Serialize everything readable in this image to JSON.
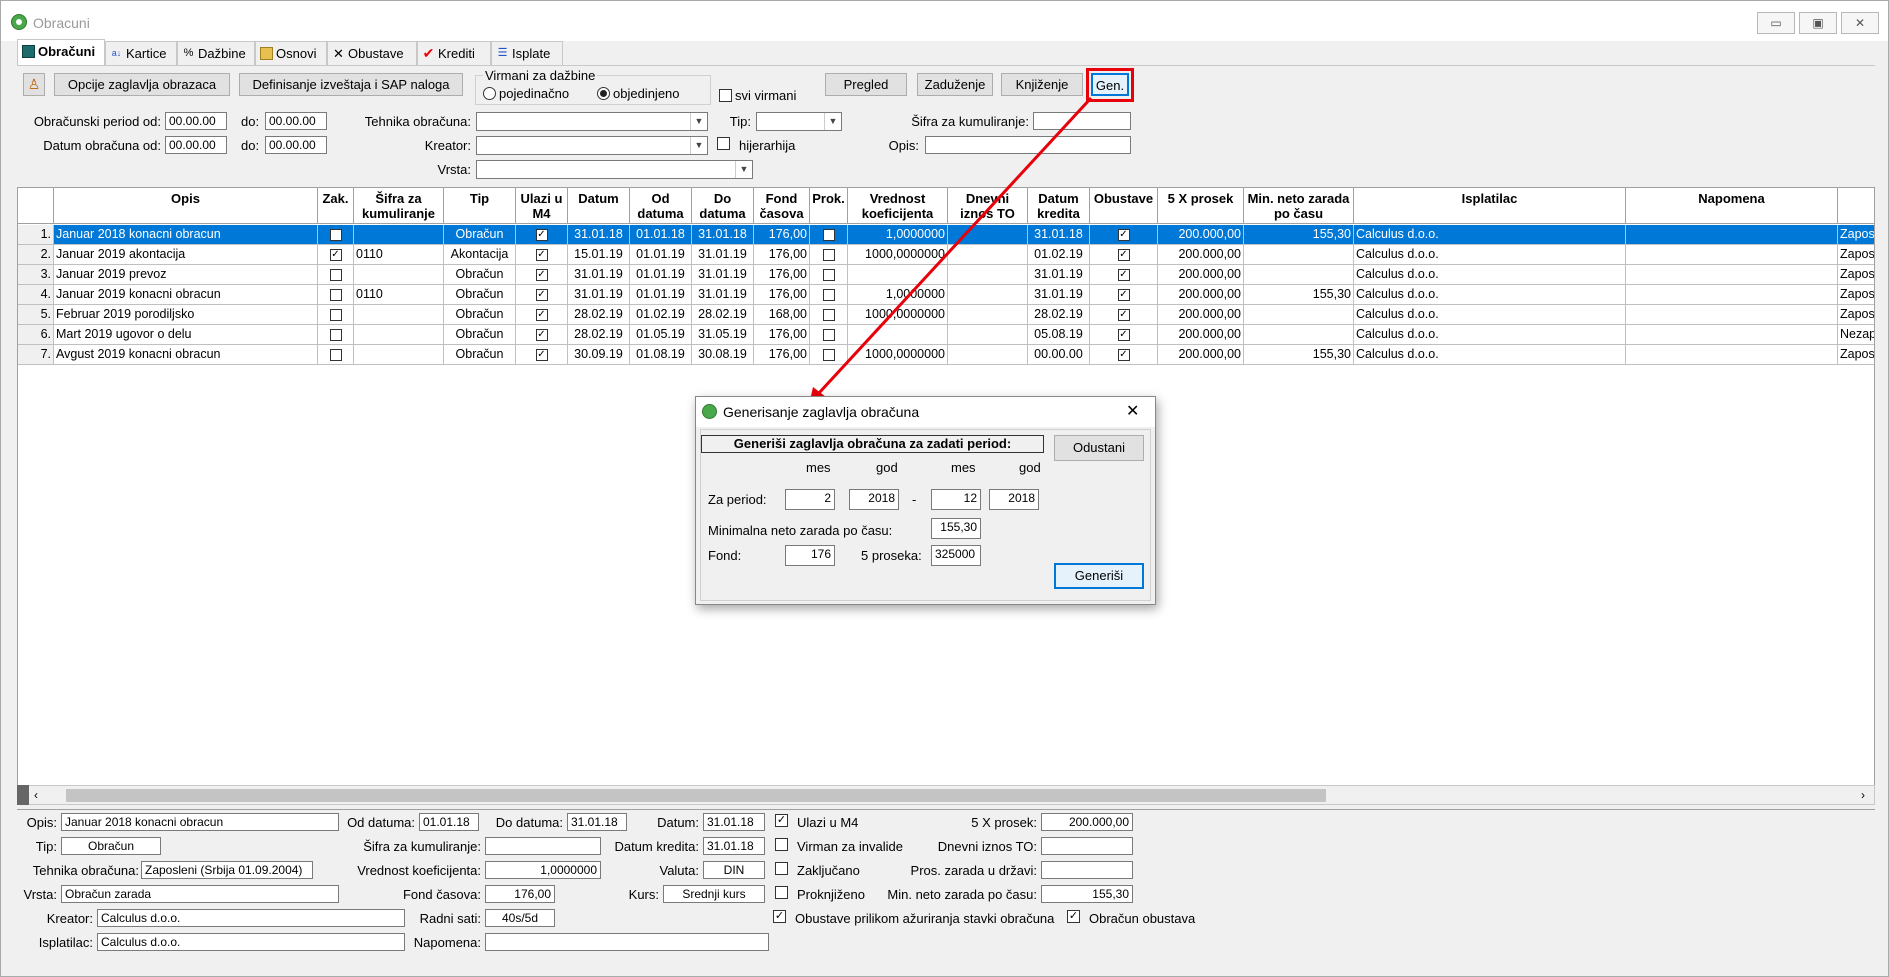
{
  "window": {
    "title": "Obracuni",
    "minimize": "▭",
    "maximize": "▣",
    "close": "✕"
  },
  "tabs": [
    {
      "label": "Obračuni",
      "icon": "grid-icon"
    },
    {
      "label": "Kartice",
      "icon": "sort-az-icon"
    },
    {
      "label": "Dažbine",
      "icon": "percent-icon"
    },
    {
      "label": "Osnovi",
      "icon": "folder-icon"
    },
    {
      "label": "Obustave",
      "icon": "cross-icon"
    },
    {
      "label": "Krediti",
      "icon": "check-icon"
    },
    {
      "label": "Isplate",
      "icon": "list-icon"
    }
  ],
  "toolbar": {
    "header_options": "Opcije zaglavlja obrazaca",
    "define_reports": "Definisanje izveštaja i SAP naloga",
    "virmani_group": "Virmani za dažbine",
    "radio_single": "pojedinačno",
    "radio_combined": "objedinjeno",
    "svi_virmani": "svi virmani",
    "pregled": "Pregled",
    "zaduzenje": "Zaduženje",
    "knjizenje": "Knjiženje",
    "gen": "Gen."
  },
  "filters": {
    "period_from_label": "Obračunski period od:",
    "period_from": "00.00.00",
    "to_label": "do:",
    "period_to": "00.00.00",
    "date_from_label": "Datum obračuna od:",
    "date_from": "00.00.00",
    "date_to": "00.00.00",
    "tehnika_label": "Tehnika obračuna:",
    "kreator_label": "Kreator:",
    "vrsta_label": "Vrsta:",
    "tip_label": "Tip:",
    "hijerarhija": "hijerarhija",
    "sifra_label": "Šifra za kumuliranje:",
    "opis_label": "Opis:"
  },
  "grid": {
    "columns": [
      {
        "label": ""
      },
      {
        "label": "Opis"
      },
      {
        "label": "Zak."
      },
      {
        "label": "Šifra za kumuliranje"
      },
      {
        "label": "Tip"
      },
      {
        "label": "Ulazi u M4"
      },
      {
        "label": "Datum"
      },
      {
        "label": "Od datuma"
      },
      {
        "label": "Do datuma"
      },
      {
        "label": "Fond časova"
      },
      {
        "label": "Prok."
      },
      {
        "label": "Vrednost koeficijenta"
      },
      {
        "label": "Dnevni iznos TO"
      },
      {
        "label": "Datum kredita"
      },
      {
        "label": "Obustave"
      },
      {
        "label": "5 X prosek"
      },
      {
        "label": "Min. neto zarada po času"
      },
      {
        "label": "Isplatilac"
      },
      {
        "label": "Napomena"
      },
      {
        "label": ""
      }
    ],
    "rows": [
      {
        "n": "1.",
        "opis": "Januar 2018 konacni obracun",
        "zak": false,
        "sifra": "",
        "tip": "Obračun",
        "m4": true,
        "datum": "31.01.18",
        "od": "01.01.18",
        "do": "31.01.18",
        "fond": "176,00",
        "prok": false,
        "koef": "1,0000000",
        "dnevni": "",
        "kredit": "31.01.18",
        "obustave": true,
        "prosek": "200.000,00",
        "minneto": "155,30",
        "isplatilac": "Calculus d.o.o.",
        "napomena": "",
        "extra": "Zaposle"
      },
      {
        "n": "2.",
        "opis": "Januar 2019 akontacija",
        "zak": true,
        "sifra": "0110",
        "tip": "Akontacija",
        "m4": true,
        "datum": "15.01.19",
        "od": "01.01.19",
        "do": "31.01.19",
        "fond": "176,00",
        "prok": false,
        "koef": "1000,0000000",
        "dnevni": "",
        "kredit": "01.02.19",
        "obustave": true,
        "prosek": "200.000,00",
        "minneto": "",
        "isplatilac": "Calculus d.o.o.",
        "napomena": "",
        "extra": "Zaposle"
      },
      {
        "n": "3.",
        "opis": "Januar 2019 prevoz",
        "zak": false,
        "sifra": "",
        "tip": "Obračun",
        "m4": true,
        "datum": "31.01.19",
        "od": "01.01.19",
        "do": "31.01.19",
        "fond": "176,00",
        "prok": false,
        "koef": "",
        "dnevni": "",
        "kredit": "31.01.19",
        "obustave": true,
        "prosek": "200.000,00",
        "minneto": "",
        "isplatilac": "Calculus d.o.o.",
        "napomena": "",
        "extra": "Zaposle"
      },
      {
        "n": "4.",
        "opis": "Januar 2019 konacni obracun",
        "zak": false,
        "sifra": "0110",
        "tip": "Obračun",
        "m4": true,
        "datum": "31.01.19",
        "od": "01.01.19",
        "do": "31.01.19",
        "fond": "176,00",
        "prok": false,
        "koef": "1,0000000",
        "dnevni": "",
        "kredit": "31.01.19",
        "obustave": true,
        "prosek": "200.000,00",
        "minneto": "155,30",
        "isplatilac": "Calculus d.o.o.",
        "napomena": "",
        "extra": "Zaposle"
      },
      {
        "n": "5.",
        "opis": "Februar 2019 porodiljsko",
        "zak": false,
        "sifra": "",
        "tip": "Obračun",
        "m4": true,
        "datum": "28.02.19",
        "od": "01.02.19",
        "do": "28.02.19",
        "fond": "168,00",
        "prok": false,
        "koef": "1000,0000000",
        "dnevni": "",
        "kredit": "28.02.19",
        "obustave": true,
        "prosek": "200.000,00",
        "minneto": "",
        "isplatilac": "Calculus d.o.o.",
        "napomena": "",
        "extra": "Zaposle"
      },
      {
        "n": "6.",
        "opis": "Mart 2019 ugovor o delu",
        "zak": false,
        "sifra": "",
        "tip": "Obračun",
        "m4": true,
        "datum": "28.02.19",
        "od": "01.05.19",
        "do": "31.05.19",
        "fond": "176,00",
        "prok": false,
        "koef": "",
        "dnevni": "",
        "kredit": "05.08.19",
        "obustave": true,
        "prosek": "200.000,00",
        "minneto": "",
        "isplatilac": "Calculus d.o.o.",
        "napomena": "",
        "extra": "Nezapo"
      },
      {
        "n": "7.",
        "opis": "Avgust 2019 konacni obracun",
        "zak": false,
        "sifra": "",
        "tip": "Obračun",
        "m4": true,
        "datum": "30.09.19",
        "od": "01.08.19",
        "do": "30.08.19",
        "fond": "176,00",
        "prok": false,
        "koef": "1000,0000000",
        "dnevni": "",
        "kredit": "00.00.00",
        "obustave": true,
        "prosek": "200.000,00",
        "minneto": "155,30",
        "isplatilac": "Calculus d.o.o.",
        "napomena": "",
        "extra": "Zaposle"
      }
    ]
  },
  "detail": {
    "opis_label": "Opis:",
    "opis": "Januar 2018 konacni obracun",
    "od_label": "Od datuma:",
    "od": "01.01.18",
    "do_label": "Do datuma:",
    "do": "31.01.18",
    "datum_label": "Datum:",
    "datum": "31.01.18",
    "m4": "Ulazi u M4",
    "prosek_label": "5 X prosek:",
    "prosek": "200.000,00",
    "tip_label": "Tip:",
    "tip": "Obračun",
    "sifra_label": "Šifra za kumuliranje:",
    "sifra": "",
    "kredit_label": "Datum kredita:",
    "kredit": "31.01.18",
    "invalidi": "Virman za invalide",
    "dnevni_label": "Dnevni iznos TO:",
    "dnevni": "",
    "tehnika_label": "Tehnika obračuna:",
    "tehnika": "Zaposleni (Srbija 01.09.2004)",
    "koef_label": "Vrednost koeficijenta:",
    "koef": "1,0000000",
    "valuta_label": "Valuta:",
    "valuta": "DIN",
    "zakljuceno": "Zaključano",
    "pros_label": "Pros. zarada u državi:",
    "pros": "",
    "vrsta_label": "Vrsta:",
    "vrsta": "Obračun zarada",
    "fond_label": "Fond časova:",
    "fond": "176,00",
    "kurs_label": "Kurs:",
    "kurs": "Srednji kurs",
    "proknjizeno": "Proknjiženo",
    "minneto_label": "Min. neto zarada po času:",
    "minneto": "155,30",
    "kreator_label": "Kreator:",
    "kreator": "Calculus d.o.o.",
    "radni_label": "Radni sati:",
    "radni": "40s/5d",
    "obustave_azur": "Obustave prilikom ažuriranja stavki obračuna",
    "obracun_obustava": "Obračun obustava",
    "isplatilac_label": "Isplatilac:",
    "isplatilac": "Calculus d.o.o.",
    "napomena_label": "Napomena:",
    "napomena": ""
  },
  "dialog": {
    "title": "Generisanje zaglavlja obračuna",
    "heading": "Generiši zaglavlja obračuna za zadati period:",
    "mes": "mes",
    "god": "god",
    "period_label": "Za period:",
    "mes_from": "2",
    "god_from": "2018",
    "dash": "-",
    "mes_to": "12",
    "god_to": "2018",
    "minneto_label": "Minimalna neto zarada po času:",
    "minneto": "155,30",
    "fond_label": "Fond:",
    "fond": "176",
    "proseka_label": "5 proseka:",
    "proseka": "325000",
    "cancel": "Odustani",
    "generate": "Generiši",
    "close": "✕"
  },
  "accent": "#0078d7",
  "highlight": "#e8000b"
}
